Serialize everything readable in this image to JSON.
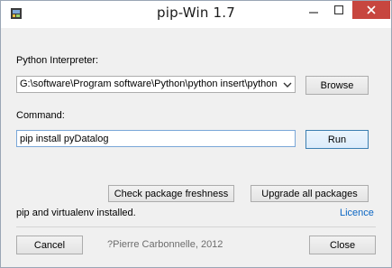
{
  "window": {
    "title": "pip-Win 1.7",
    "icons": {
      "app": "app-icon",
      "minimize": "minimize-icon",
      "maximize": "maximize-icon",
      "close": "close-icon"
    }
  },
  "interpreter": {
    "label": "Python Interpreter:",
    "value": "G:\\software\\Program software\\Python\\python insert\\python",
    "dropdown_icon": "chevron-down-icon",
    "browse_label": "Browse"
  },
  "command": {
    "label": "Command:",
    "value": "pip install pyDatalog",
    "run_label": "Run"
  },
  "actions": {
    "check_label": "Check package freshness",
    "upgrade_label": "Upgrade all packages"
  },
  "status": {
    "text": "pip and virtualenv installed.",
    "licence_label": "Licence"
  },
  "footer": {
    "cancel_label": "Cancel",
    "copyright": "?Pierre Carbonnelle, 2012",
    "close_label": "Close"
  },
  "colors": {
    "close_button": "#c7463f",
    "link": "#0b66c3",
    "background": "#f0f0f0"
  }
}
